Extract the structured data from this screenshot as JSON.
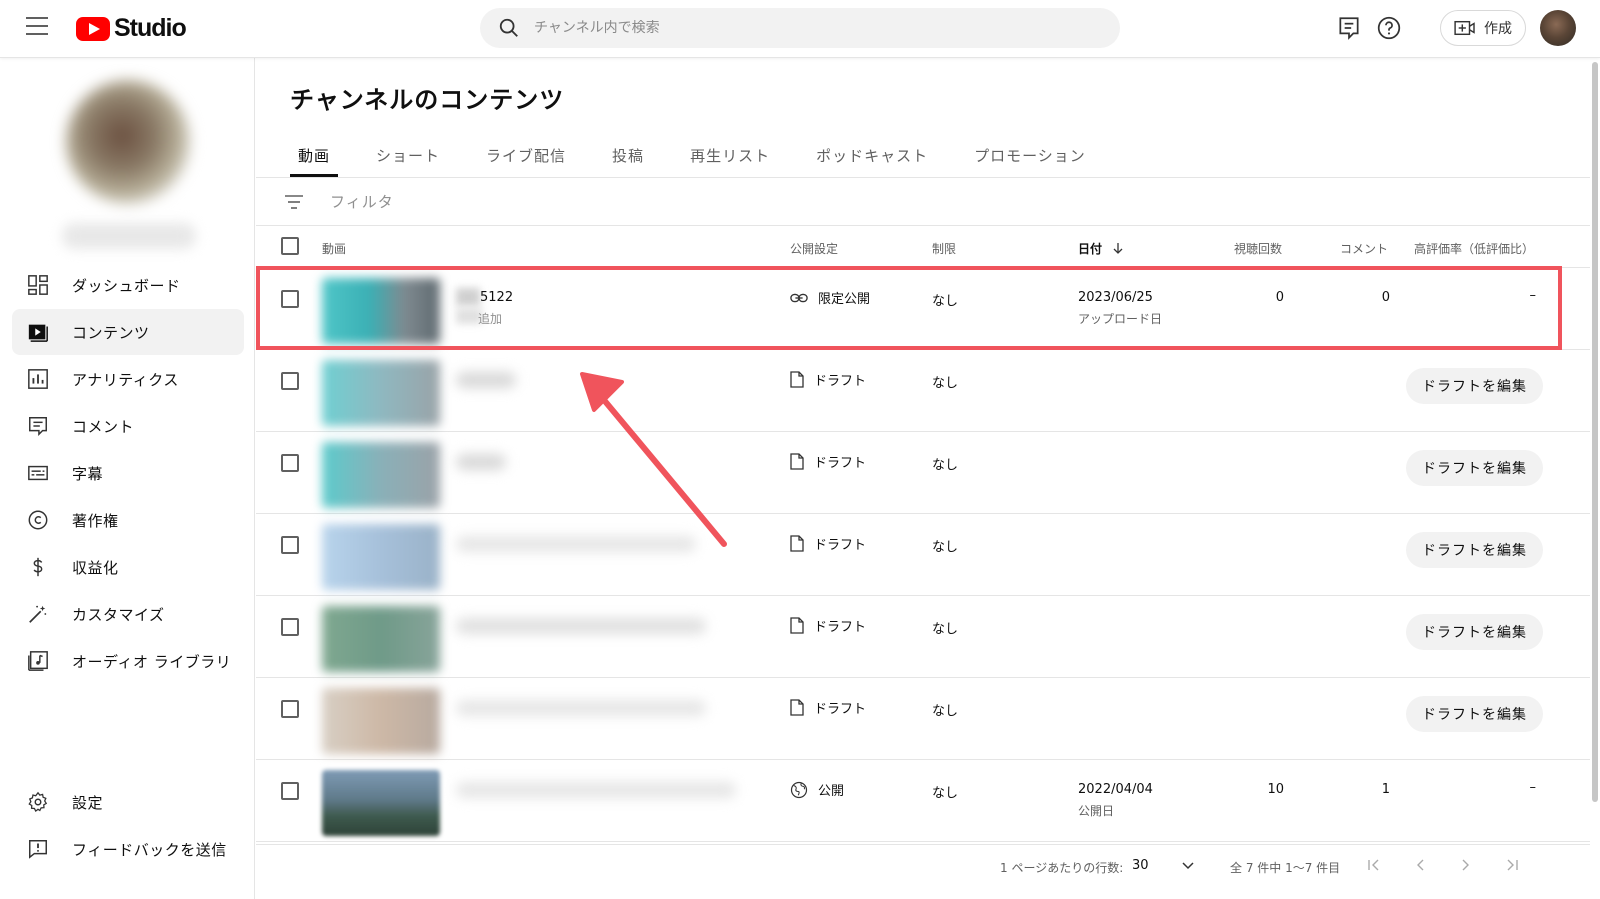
{
  "app": {
    "logo_text": "Studio"
  },
  "search": {
    "placeholder": "チャンネル内で検索"
  },
  "header": {
    "create_label": "作成"
  },
  "sidebar": {
    "items": [
      {
        "label": "ダッシュボード",
        "icon": "dashboard-icon"
      },
      {
        "label": "コンテンツ",
        "icon": "content-icon",
        "active": true
      },
      {
        "label": "アナリティクス",
        "icon": "analytics-icon"
      },
      {
        "label": "コメント",
        "icon": "comments-icon"
      },
      {
        "label": "字幕",
        "icon": "subtitles-icon"
      },
      {
        "label": "著作権",
        "icon": "copyright-icon"
      },
      {
        "label": "収益化",
        "icon": "monetization-icon"
      },
      {
        "label": "カスタマイズ",
        "icon": "customize-icon"
      },
      {
        "label": "オーディオ ライブラリ",
        "icon": "audio-library-icon"
      }
    ],
    "bottom": [
      {
        "label": "設定",
        "icon": "settings-icon"
      },
      {
        "label": "フィードバックを送信",
        "icon": "feedback-icon"
      }
    ]
  },
  "main": {
    "title": "チャンネルのコンテンツ",
    "tabs": [
      "動画",
      "ショート",
      "ライブ配信",
      "投稿",
      "再生リスト",
      "ポッドキャスト",
      "プロモーション"
    ],
    "filter_label": "フィルタ",
    "columns": {
      "video": "動画",
      "visibility": "公開設定",
      "restrictions": "制限",
      "date": "日付",
      "views": "視聴回数",
      "comments": "コメント",
      "likes": "高評価率（低評価比）"
    },
    "rows": [
      {
        "title": "5122",
        "subtitle": "追加",
        "visibility": "限定公開",
        "restrictions": "なし",
        "date": "2023/06/25",
        "date_sub": "アップロード日",
        "views": "0",
        "comments": "0",
        "likes": "–"
      },
      {
        "visibility": "ドラフト",
        "restrictions": "なし",
        "action": "ドラフトを編集"
      },
      {
        "visibility": "ドラフト",
        "restrictions": "なし",
        "action": "ドラフトを編集"
      },
      {
        "visibility": "ドラフト",
        "restrictions": "なし",
        "action": "ドラフトを編集"
      },
      {
        "visibility": "ドラフト",
        "restrictions": "なし",
        "action": "ドラフトを編集"
      },
      {
        "visibility": "ドラフト",
        "restrictions": "なし",
        "action": "ドラフトを編集"
      },
      {
        "visibility": "公開",
        "restrictions": "なし",
        "date": "2022/04/04",
        "date_sub": "公開日",
        "views": "10",
        "comments": "1",
        "likes": "–"
      }
    ]
  },
  "footer": {
    "rows_per_page_label": "1 ページあたりの行数:",
    "rows_per_page": "30",
    "range": "全 7 件中 1〜7 件目"
  },
  "colors": {
    "highlight": "#f0545c",
    "brand_red": "#ff0000"
  }
}
